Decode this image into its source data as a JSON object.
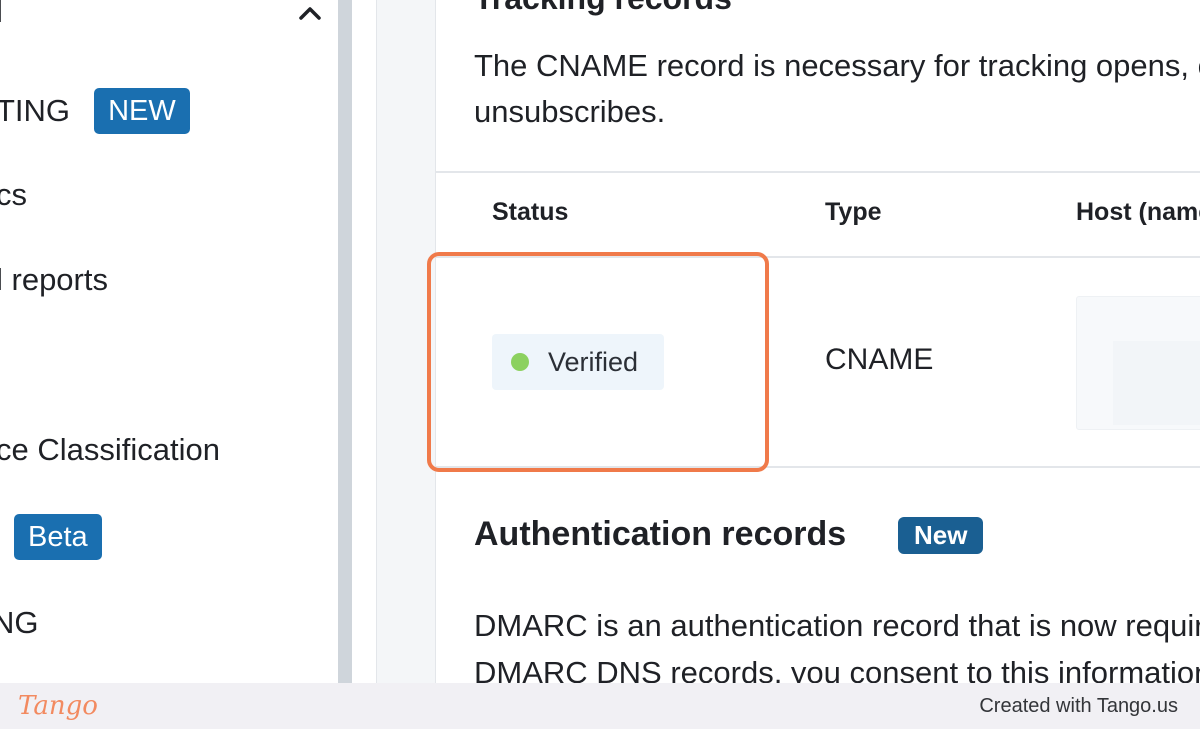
{
  "sidebar": {
    "items": [
      {
        "label": "l"
      },
      {
        "label": "TING",
        "badge": "NEW"
      },
      {
        "label": "cs"
      },
      {
        "label": "l reports"
      },
      {
        "label": "ce Classification"
      },
      {
        "label": "",
        "badge": "Beta"
      },
      {
        "label": "NG"
      }
    ]
  },
  "tracking": {
    "title": "Tracking records",
    "description_line1": "The CNAME record is necessary for tracking opens, clicks and",
    "description_line2": "unsubscribes."
  },
  "table": {
    "headers": [
      "Status",
      "Type",
      "Host (name)"
    ],
    "row": {
      "status": "Verified",
      "type": "CNAME"
    }
  },
  "authentication": {
    "title": "Authentication records",
    "badge": "New",
    "description_line1": "DMARC is an authentication record that is now required",
    "description_line2": "DMARC DNS records, you consent to this information"
  },
  "footer": {
    "logo": "Tango",
    "credit": "Created with Tango.us"
  },
  "colors": {
    "accent": "#1a6fb0",
    "verified_dot": "#8cd15f",
    "highlight": "#f07a4a"
  }
}
